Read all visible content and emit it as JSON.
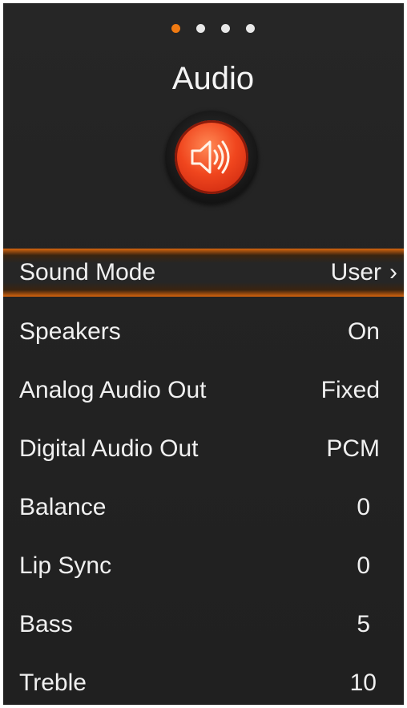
{
  "pager": {
    "count": 4,
    "active_index": 0
  },
  "header": {
    "title": "Audio"
  },
  "icon": {
    "name": "speaker-icon",
    "accent_color": "#f0461e"
  },
  "menu": {
    "selected_index": 0,
    "items": [
      {
        "label": "Sound Mode",
        "value": "User",
        "has_submenu": true
      },
      {
        "label": "Speakers",
        "value": "On"
      },
      {
        "label": "Analog Audio Out",
        "value": "Fixed"
      },
      {
        "label": "Digital Audio Out",
        "value": "PCM"
      },
      {
        "label": "Balance",
        "value": "0"
      },
      {
        "label": "Lip Sync",
        "value": "0"
      },
      {
        "label": "Bass",
        "value": "5"
      },
      {
        "label": "Treble",
        "value": "10"
      }
    ]
  },
  "colors": {
    "accent": "#f07a12",
    "background": "#232323",
    "text": "#f0f0f0"
  }
}
